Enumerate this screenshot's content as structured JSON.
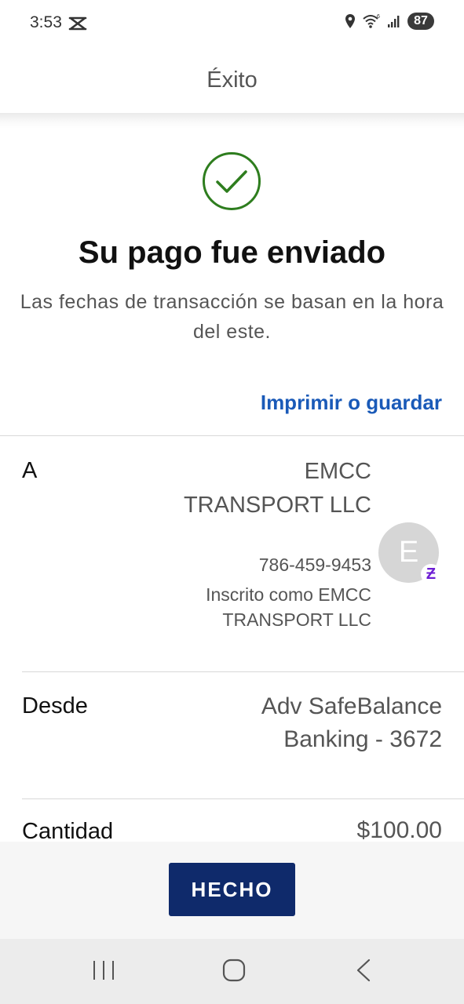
{
  "status_bar": {
    "time": "3:53",
    "battery": "87"
  },
  "header": {
    "title": "Éxito"
  },
  "confirmation": {
    "title": "Su pago fue enviado",
    "subtitle": "Las fechas de transacción se basan en la hora del este.",
    "print_link": "Imprimir o guardar"
  },
  "recipient": {
    "label": "A",
    "name": "EMCC TRANSPORT LLC",
    "phone": "786-459-9453",
    "enrolled": "Inscrito como EMCC TRANSPORT LLC",
    "avatar_initial": "E",
    "badge": "Ƶ"
  },
  "from": {
    "label": "Desde",
    "account": "Adv SafeBalance Banking - 3672"
  },
  "amount": {
    "label": "Cantidad",
    "value": "$100.00"
  },
  "footer": {
    "done_label": "HECHO"
  },
  "colors": {
    "accent": "#1a5ab8",
    "button": "#0f2a6b",
    "success": "#2e7d1e",
    "zelle": "#6d1ed4"
  }
}
